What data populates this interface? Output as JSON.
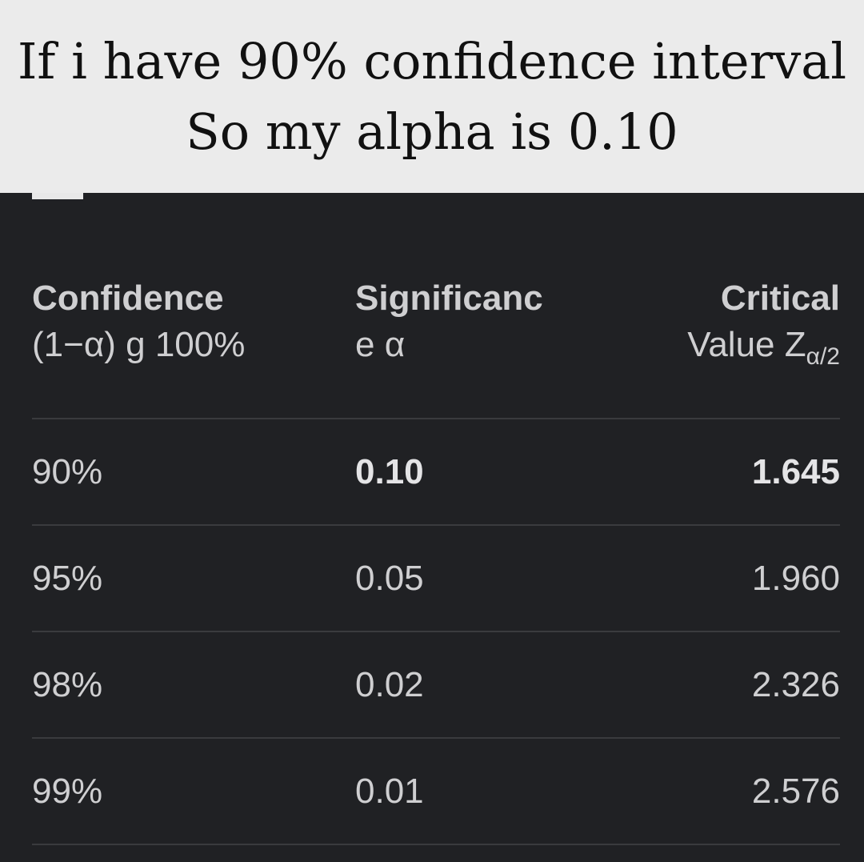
{
  "caption": {
    "line1": "If i have 90% confidence interval",
    "line2": "So my alpha is 0.10"
  },
  "table": {
    "headers": {
      "confidence": {
        "line1": "Confidence",
        "line2": "(1−α) g 100%"
      },
      "significance": {
        "line1": "Significanc",
        "line2": "e α"
      },
      "critical": {
        "line1": "Critical",
        "line2_main": "Value Z",
        "line2_sub": "α/2"
      }
    },
    "rows": [
      {
        "confidence": "90%",
        "significance": "0.10",
        "critical": "1.645",
        "highlighted": true
      },
      {
        "confidence": "95%",
        "significance": "0.05",
        "critical": "1.960",
        "highlighted": false
      },
      {
        "confidence": "98%",
        "significance": "0.02",
        "critical": "2.326",
        "highlighted": false
      },
      {
        "confidence": "99%",
        "significance": "0.01",
        "critical": "2.576",
        "highlighted": false
      }
    ]
  },
  "colors": {
    "background": "#202124",
    "caption_background": "#ebebeb",
    "text": "#cfcfd1",
    "divider": "#3a3b3e"
  }
}
